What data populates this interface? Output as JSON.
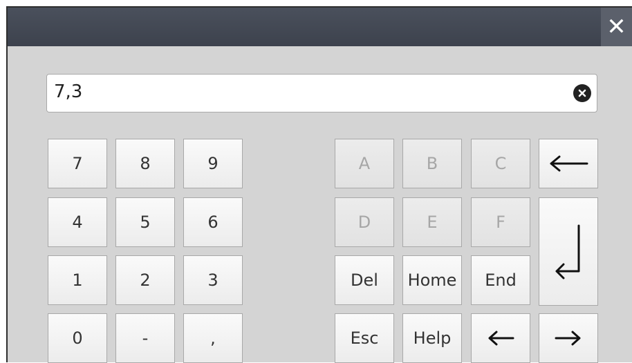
{
  "dialog": {
    "close_icon": "close-icon"
  },
  "input": {
    "value": "7,3",
    "clear_icon": "clear-x-icon"
  },
  "numpad": {
    "keys": [
      "7",
      "8",
      "9",
      "4",
      "5",
      "6",
      "1",
      "2",
      "3",
      "0",
      "-",
      ","
    ]
  },
  "hexpad": {
    "keys": [
      "A",
      "B",
      "C",
      "D",
      "E",
      "F"
    ],
    "disabled": true
  },
  "navpad": {
    "del": "Del",
    "home": "Home",
    "end": "End",
    "esc": "Esc",
    "help": "Help",
    "backspace_icon": "backspace-arrow-icon",
    "enter_icon": "enter-return-icon",
    "left_icon": "arrow-left-icon",
    "right_icon": "arrow-right-icon"
  }
}
